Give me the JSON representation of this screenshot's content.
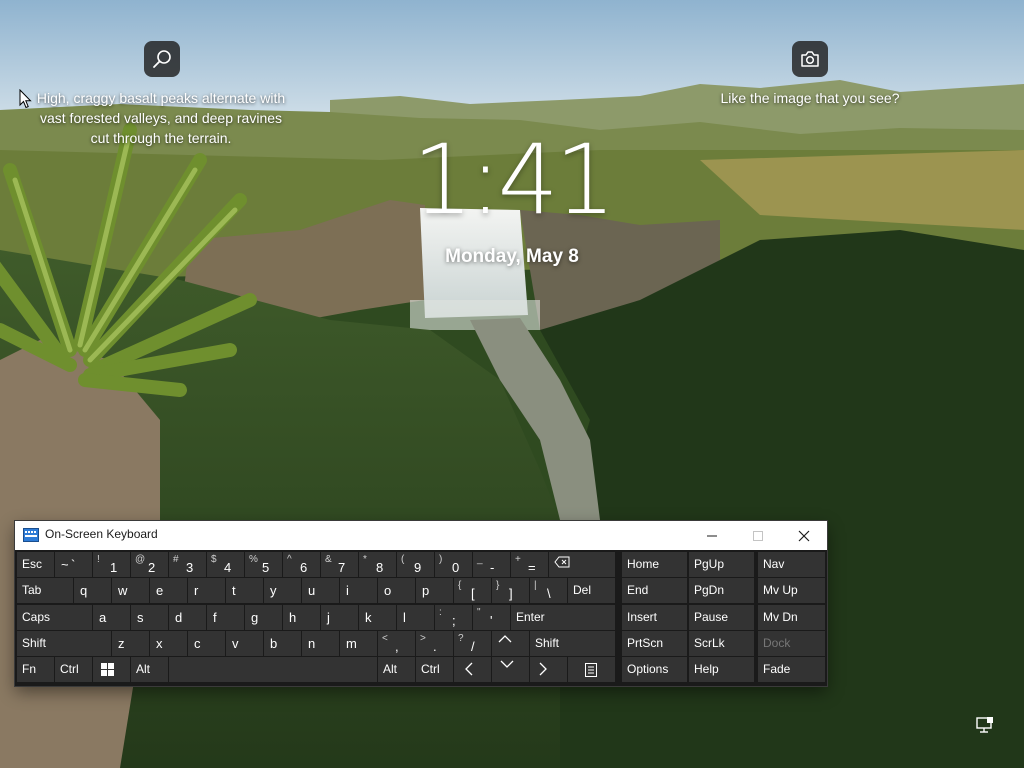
{
  "lock_screen": {
    "clock": "1:41",
    "date": "Monday, May 8",
    "image_description": "High, craggy basalt peaks alternate with vast forested valleys, and deep ravines cut through the terrain.",
    "like_prompt": "Like the image that you see?",
    "icons": {
      "search": "search-icon",
      "camera": "camera-icon",
      "network": "network-icon"
    }
  },
  "osk": {
    "title": "On-Screen Keyboard",
    "window_controls": {
      "minimize": "minimize-icon",
      "maximize": "maximize-icon",
      "close": "close-icon"
    },
    "keys": {
      "esc": "Esc",
      "tilde_shift": "~",
      "tilde": "`",
      "n1_shift": "!",
      "n1": "1",
      "n2_shift": "@",
      "n2": "2",
      "n3_shift": "#",
      "n3": "3",
      "n4_shift": "$",
      "n4": "4",
      "n5_shift": "%",
      "n5": "5",
      "n6_shift": "^",
      "n6": "6",
      "n7_shift": "&",
      "n7": "7",
      "n8_shift": "*",
      "n8": "8",
      "n9_shift": "(",
      "n9": "9",
      "n0_shift": ")",
      "n0": "0",
      "minus_shift": "_",
      "minus": "-",
      "equal_shift": "+",
      "equal": "=",
      "tab": "Tab",
      "q": "q",
      "w": "w",
      "e": "e",
      "r": "r",
      "t": "t",
      "y": "y",
      "u": "u",
      "i": "i",
      "o": "o",
      "p": "p",
      "lbracket_shift": "{",
      "lbracket": "[",
      "rbracket_shift": "}",
      "rbracket": "]",
      "backslash_shift": "|",
      "backslash": "\\",
      "del": "Del",
      "caps": "Caps",
      "a": "a",
      "s": "s",
      "d": "d",
      "f": "f",
      "g": "g",
      "h": "h",
      "j": "j",
      "k": "k",
      "l": "l",
      "semicolon_shift": ":",
      "semicolon": ";",
      "quote_shift": "\"",
      "quote": "'",
      "enter": "Enter",
      "shift": "Shift",
      "z": "z",
      "x": "x",
      "c": "c",
      "v": "v",
      "b": "b",
      "n": "n",
      "m": "m",
      "comma_shift": "<",
      "comma": ",",
      "period_shift": ">",
      "period": ".",
      "slash_shift": "?",
      "slash": "/",
      "fn": "Fn",
      "ctrl": "Ctrl",
      "alt": "Alt",
      "home": "Home",
      "pgup": "PgUp",
      "nav": "Nav",
      "end": "End",
      "pgdn": "PgDn",
      "mvup": "Mv Up",
      "insert": "Insert",
      "pause": "Pause",
      "mvdn": "Mv Dn",
      "prtscn": "PrtScn",
      "scrlk": "ScrLk",
      "dock": "Dock",
      "options": "Options",
      "help": "Help",
      "fade": "Fade"
    }
  }
}
